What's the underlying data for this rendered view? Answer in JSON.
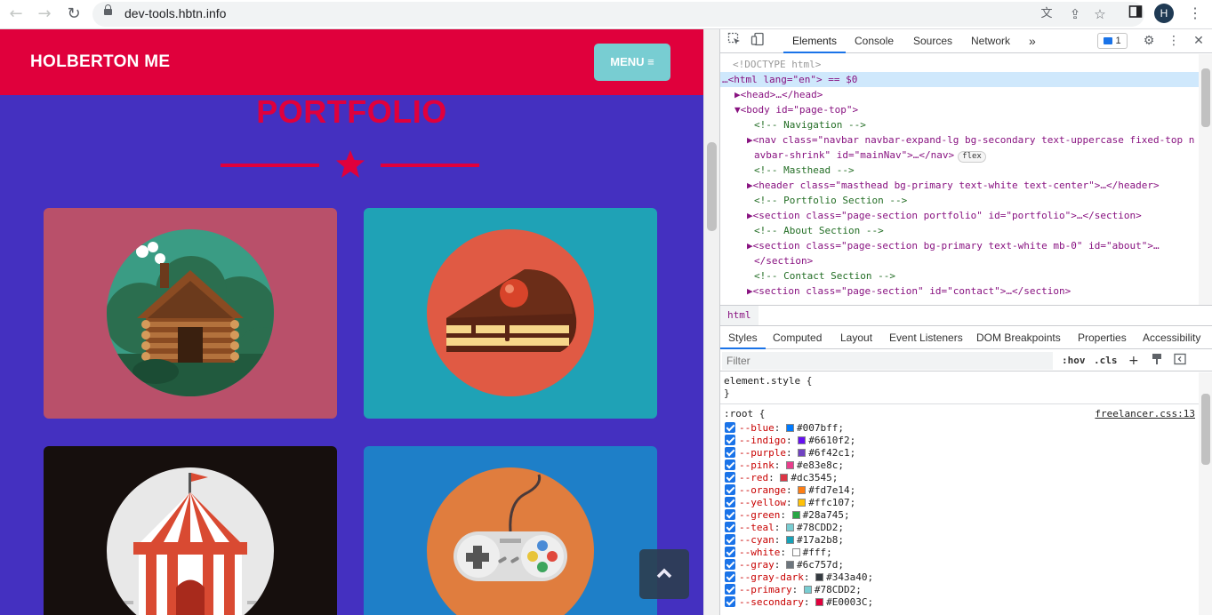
{
  "browser": {
    "url": "dev-tools.hbtn.info",
    "avatar_letter": "H",
    "icons": [
      "back-icon",
      "forward-icon",
      "reload-icon",
      "lock-icon",
      "translate-icon",
      "share-icon",
      "bookmark-star-icon",
      "side-panel-icon",
      "menu-kebab-icon"
    ]
  },
  "site": {
    "brand": "HOLBERTON ME",
    "menu_label": "MENU ≡",
    "section_title": "PORTFOLIO",
    "cards": [
      {
        "name": "cabin",
        "bg": "#b9506a",
        "circle": "#3a9c84"
      },
      {
        "name": "cake",
        "bg": "#1fa2b6",
        "circle": "#e05a44"
      },
      {
        "name": "circus",
        "bg": "#160f0d",
        "circle": "#e8e8e8"
      },
      {
        "name": "game",
        "bg": "#1e7fc8",
        "circle": "#e07d3e"
      }
    ],
    "colors": {
      "primary": "#4430c0",
      "secondary": "#e0003c",
      "teal": "#78CDD2"
    }
  },
  "devtools": {
    "tabs": [
      "Elements",
      "Console",
      "Sources",
      "Network"
    ],
    "active_tab": "Elements",
    "more_tabs": "»",
    "issues_count": "1",
    "dom": [
      {
        "indent": 14,
        "text": "<!DOCTYPE html>"
      },
      {
        "indent": 2,
        "text": "…<html lang=\"en\"> == $0"
      },
      {
        "indent": 14,
        "text": "▶<head>…</head>"
      },
      {
        "indent": 14,
        "text": "▼<body id=\"page-top\">"
      },
      {
        "indent": 38,
        "text": "<!-- Navigation -->"
      },
      {
        "indent": 30,
        "text": "▶<nav class=\"navbar navbar-expand-lg bg-secondary text-uppercase fixed-top n"
      },
      {
        "indent": 38,
        "text": "avbar-shrink\" id=\"mainNav\">…</nav>"
      },
      {
        "indent": 38,
        "text": "<!-- Masthead -->"
      },
      {
        "indent": 30,
        "text": "▶<header class=\"masthead bg-primary text-white text-center\">…</header>"
      },
      {
        "indent": 38,
        "text": "<!-- Portfolio Section -->"
      },
      {
        "indent": 30,
        "text": "▶<section class=\"page-section portfolio\" id=\"portfolio\">…</section>"
      },
      {
        "indent": 38,
        "text": "<!-- About Section -->"
      },
      {
        "indent": 30,
        "text": "▶<section class=\"page-section bg-primary text-white mb-0\" id=\"about\">…"
      },
      {
        "indent": 38,
        "text": "</section>"
      },
      {
        "indent": 38,
        "text": "<!-- Contact Section -->"
      },
      {
        "indent": 30,
        "text": "▶<section class=\"page-section\" id=\"contact\">…</section>"
      }
    ],
    "flex_badge": "flex",
    "breadcrumb": "html",
    "styles_tabs": [
      "Styles",
      "Computed",
      "Layout",
      "Event Listeners",
      "DOM Breakpoints",
      "Properties",
      "Accessibility"
    ],
    "filter_placeholder": "Filter",
    "hov": ":hov",
    "cls": ".cls",
    "element_style_open": "element.style {",
    "element_style_close": "}",
    "root_selector": ":root {",
    "root_source": "freelancer.css:13",
    "variables": [
      {
        "name": "--blue",
        "value": "#007bff"
      },
      {
        "name": "--indigo",
        "value": "#6610f2"
      },
      {
        "name": "--purple",
        "value": "#6f42c1"
      },
      {
        "name": "--pink",
        "value": "#e83e8c"
      },
      {
        "name": "--red",
        "value": "#dc3545"
      },
      {
        "name": "--orange",
        "value": "#fd7e14"
      },
      {
        "name": "--yellow",
        "value": "#ffc107"
      },
      {
        "name": "--green",
        "value": "#28a745"
      },
      {
        "name": "--teal",
        "value": "#78CDD2"
      },
      {
        "name": "--cyan",
        "value": "#17a2b8"
      },
      {
        "name": "--white",
        "value": "#fff"
      },
      {
        "name": "--gray",
        "value": "#6c757d"
      },
      {
        "name": "--gray-dark",
        "value": "#343a40"
      },
      {
        "name": "--primary",
        "value": "#78CDD2"
      },
      {
        "name": "--secondary",
        "value": "#E0003C"
      }
    ]
  }
}
